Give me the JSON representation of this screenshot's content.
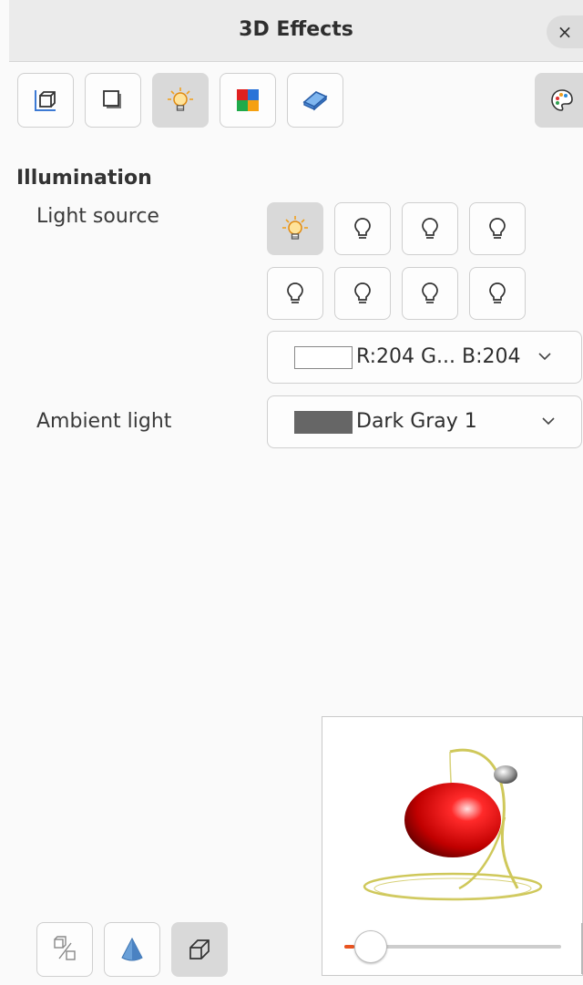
{
  "window": {
    "title": "3D Effects",
    "close_label": "×"
  },
  "toolbar": {
    "items": [
      {
        "name": "geometry",
        "icon": "geometry-icon"
      },
      {
        "name": "shading",
        "icon": "shading-icon"
      },
      {
        "name": "illumination",
        "icon": "illumination-icon",
        "active": true
      },
      {
        "name": "textures",
        "icon": "textures-icon"
      },
      {
        "name": "material",
        "icon": "material-icon"
      }
    ],
    "favorites_icon": "palette-icon"
  },
  "illumination": {
    "section_title": "Illumination",
    "light_source_label": "Light source",
    "light_source_color": {
      "swatch": "#ffffff",
      "text": "R:204 G... B:204"
    },
    "ambient_light_label": "Ambient light",
    "ambient_light_color": {
      "swatch": "#666666",
      "text": "Dark Gray 1"
    },
    "light_buttons": [
      {
        "index": 1,
        "on": true
      },
      {
        "index": 2,
        "on": false
      },
      {
        "index": 3,
        "on": false
      },
      {
        "index": 4,
        "on": false
      },
      {
        "index": 5,
        "on": false
      },
      {
        "index": 6,
        "on": false
      },
      {
        "index": 7,
        "on": false
      },
      {
        "index": 8,
        "on": false
      }
    ]
  },
  "bottom_buttons": [
    {
      "name": "convert-to-3d",
      "icon": "convert-to-3d-icon"
    },
    {
      "name": "convert-to-lathe",
      "icon": "lathe-object-icon"
    },
    {
      "name": "perspective",
      "icon": "perspective-icon",
      "active": true
    }
  ],
  "preview": {
    "slider_value": 0.12,
    "accent": "#e95420"
  }
}
